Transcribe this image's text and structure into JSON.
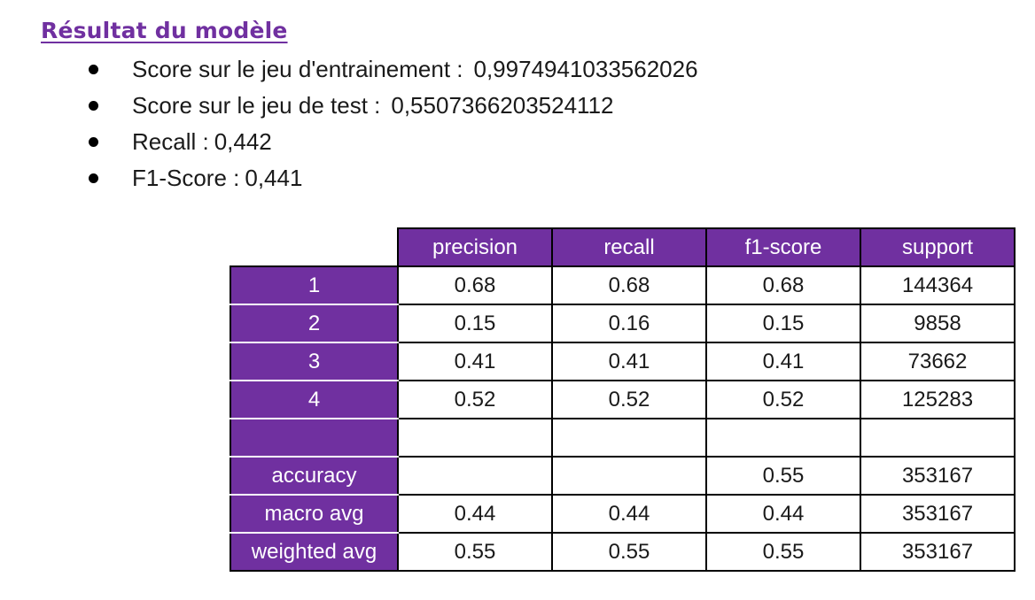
{
  "title": "Résultat du modèle",
  "bullets": [
    {
      "label": "Score sur le jeu d'entrainement :",
      "value": "0,9974941033562026"
    },
    {
      "label": "Score sur le jeu de test :",
      "value": "0,5507366203524112"
    },
    {
      "label": "Recall :",
      "value": "0,442"
    },
    {
      "label": "F1-Score :",
      "value": "0,441"
    }
  ],
  "table": {
    "columns": [
      "precision",
      "recall",
      "f1-score",
      "support"
    ],
    "rows": [
      {
        "label": "1",
        "cells": [
          "0.68",
          "0.68",
          "0.68",
          "144364"
        ]
      },
      {
        "label": "2",
        "cells": [
          "0.15",
          "0.16",
          "0.15",
          "9858"
        ]
      },
      {
        "label": "3",
        "cells": [
          "0.41",
          "0.41",
          "0.41",
          "73662"
        ]
      },
      {
        "label": "4",
        "cells": [
          "0.52",
          "0.52",
          "0.52",
          "125283"
        ]
      },
      {
        "label": "",
        "cells": [
          "",
          "",
          "",
          ""
        ]
      },
      {
        "label": "accuracy",
        "cells": [
          "",
          "",
          "0.55",
          "353167"
        ]
      },
      {
        "label": "macro avg",
        "cells": [
          "0.44",
          "0.44",
          "0.44",
          "353167"
        ]
      },
      {
        "label": "weighted avg",
        "cells": [
          "0.55",
          "0.55",
          "0.55",
          "353167"
        ]
      }
    ]
  },
  "colors": {
    "accent": "#7030a0"
  }
}
